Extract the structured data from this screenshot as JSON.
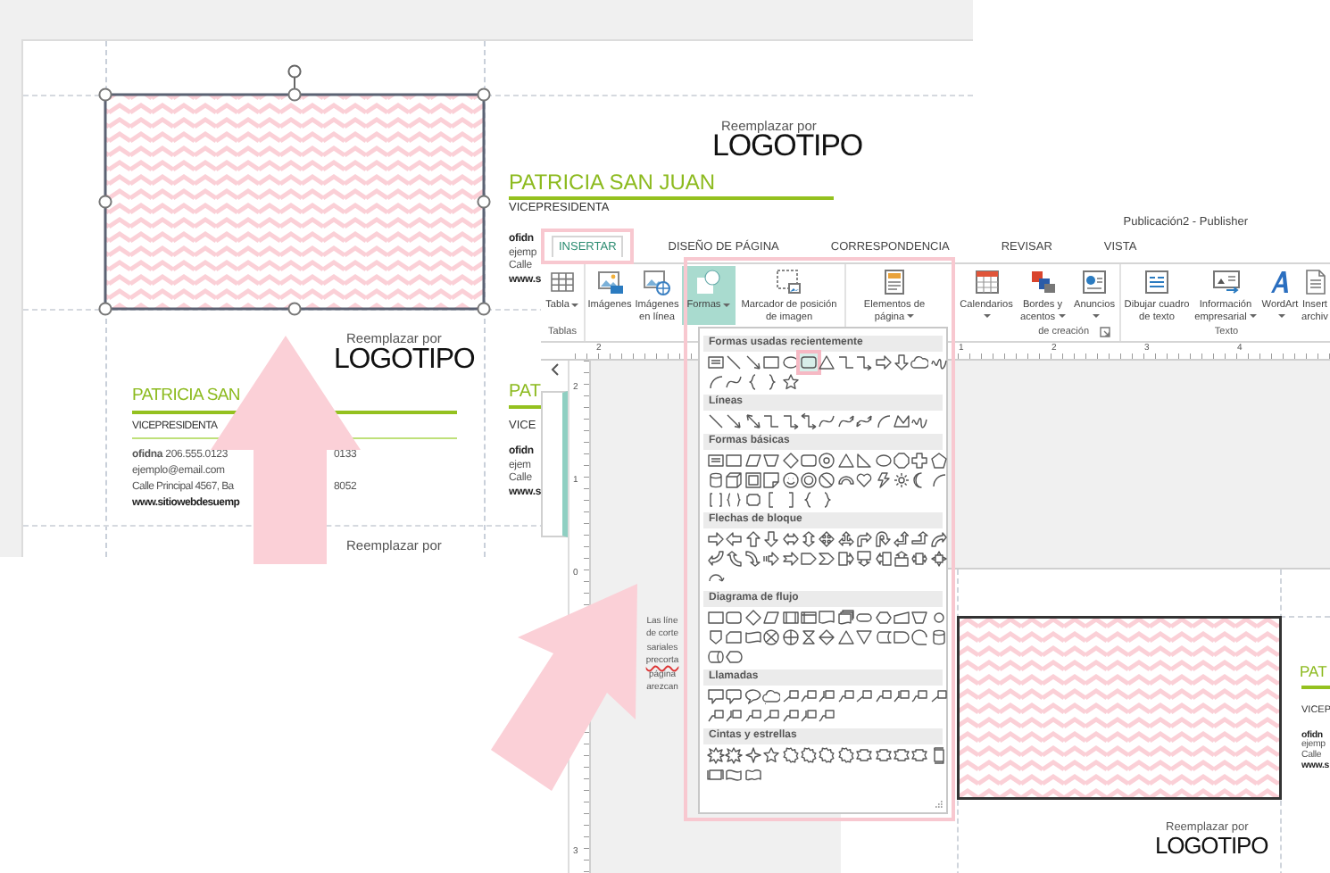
{
  "back_document": {
    "card_below": {
      "logo_caption": "Reemplazar por",
      "logo": "LOGOTIPO",
      "name": "PATRICIA SAN",
      "title": "VICEPRESIDENTA",
      "office": "**ofidna** 206.555.0123",
      "office_tail": "0133",
      "email": "ejemplo@email.com",
      "address": "Calle Principal 4567, Ba",
      "address_tail": "8052",
      "website": "www.sitiowebdesuemp"
    },
    "card_right": {
      "logo_caption": "Reemplazar por",
      "logo": "LOGOTIPO",
      "name": "PATRICIA SAN JUAN",
      "title": "VICEPRESIDENTA",
      "lines": [
        "ofidn",
        "ejemp",
        "Calle",
        "www.s"
      ]
    },
    "card_right_lower": {
      "name": "PAT",
      "title": "VICE",
      "lines": [
        "ofidn",
        "ejem",
        "Calle",
        "www.s"
      ]
    },
    "bottom_caption": "Reemplazar por"
  },
  "publisher": {
    "title": "Publicación2 - Publisher",
    "tabs": [
      {
        "label": "INSERTAR",
        "selected": true,
        "highlighted": true
      },
      {
        "label": "DISEÑO DE PÁGINA",
        "selected": false,
        "highlighted": false
      },
      {
        "label": "CORRESPONDENCIA",
        "selected": false,
        "highlighted": false
      },
      {
        "label": "REVISAR",
        "selected": false,
        "highlighted": false
      },
      {
        "label": "VISTA",
        "selected": false,
        "highlighted": false
      }
    ],
    "ribbon": [
      {
        "label": "Tablas",
        "buttons": [
          {
            "label": "Tabla",
            "kind": "table",
            "menu": true,
            "selected": false
          }
        ]
      },
      {
        "buttons": [
          {
            "label": "Imágenes",
            "kind": "picture",
            "menu": false,
            "selected": false
          },
          {
            "label": "Imágenes en línea",
            "kind": "online-picture",
            "menu": false,
            "selected": false
          },
          {
            "label": "Formas",
            "kind": "shapes",
            "menu": true,
            "selected": true
          },
          {
            "label": "Marcador de posición de imagen",
            "kind": "placeholder",
            "menu": false,
            "selected": false
          }
        ]
      },
      {
        "label": "de creación",
        "buttons": [
          {
            "label": "Elementos de página",
            "kind": "page-parts",
            "menu": true,
            "selected": false
          },
          {
            "label": "Calendarios",
            "kind": "calendar",
            "menu": true,
            "selected": false
          },
          {
            "label": "Bordes y acentos",
            "kind": "borders",
            "menu": true,
            "selected": false
          },
          {
            "label": "Anuncios",
            "kind": "advertisement",
            "menu": true,
            "selected": false
          }
        ]
      },
      {
        "label": "Texto",
        "buttons": [
          {
            "label": "Dibujar cuadro de texto",
            "kind": "text-box",
            "menu": false,
            "selected": false
          },
          {
            "label": "Información empresarial",
            "kind": "business",
            "menu": true,
            "selected": false
          },
          {
            "label": "WordArt",
            "kind": "wordart",
            "menu": true,
            "selected": false
          },
          {
            "label": "Insert archiv",
            "kind": "file",
            "menu": false,
            "selected": false
          }
        ]
      }
    ],
    "horizontal_ruler": {
      "left_labels": [
        "2"
      ],
      "right_labels": [
        "1",
        "2",
        "3",
        "4"
      ]
    },
    "vertical_ruler": {
      "upper_labels": [
        "2",
        "1",
        "0"
      ],
      "lower_labels": [
        "3"
      ]
    },
    "canvas_note": [
      {
        "text": "Las líne",
        "misspelled": false
      },
      {
        "text": "de corte",
        "misspelled": false
      },
      {
        "text": "sariales",
        "misspelled": false
      },
      {
        "text": "precorta",
        "misspelled": true
      },
      {
        "text": "página",
        "misspelled": false
      },
      {
        "text": "arezcan",
        "misspelled": false
      }
    ],
    "page_preview": {
      "name": "PAT",
      "title": "VICEP",
      "lines": [
        "ofidn",
        "ejemp",
        "Calle",
        "www.s"
      ],
      "logo_caption": "Reemplazar por",
      "logo": "LOGOTIPO"
    }
  },
  "shape_menu": {
    "sections": [
      {
        "title": "Formas usadas recientemente",
        "shapes": [
          {
            "kind": "textbox",
            "highlighted": false
          },
          {
            "kind": "line",
            "highlighted": false
          },
          {
            "kind": "arrow-line",
            "highlighted": false
          },
          {
            "kind": "rectangle",
            "highlighted": false
          },
          {
            "kind": "oval",
            "highlighted": false
          },
          {
            "kind": "rounded-rectangle",
            "highlighted": true
          },
          {
            "kind": "triangle",
            "highlighted": false
          },
          {
            "kind": "elbow",
            "highlighted": false
          },
          {
            "kind": "elbow-arrow",
            "highlighted": false
          },
          {
            "kind": "arrow-right",
            "highlighted": false
          },
          {
            "kind": "arrow-down",
            "highlighted": false
          },
          {
            "kind": "cloud",
            "highlighted": false
          },
          {
            "kind": "scribble",
            "highlighted": false
          },
          {
            "kind": "arc",
            "highlighted": false
          },
          {
            "kind": "curve",
            "highlighted": false
          },
          {
            "kind": "brace-left",
            "highlighted": false
          },
          {
            "kind": "brace-right",
            "highlighted": false
          },
          {
            "kind": "star",
            "highlighted": false
          }
        ]
      },
      {
        "title": "Líneas",
        "shapes": [
          {
            "kind": "line",
            "highlighted": false
          },
          {
            "kind": "arrow-line",
            "highlighted": false
          },
          {
            "kind": "double-arrow-line",
            "highlighted": false
          },
          {
            "kind": "elbow",
            "highlighted": false
          },
          {
            "kind": "elbow-arrow",
            "highlighted": false
          },
          {
            "kind": "elbow-double-arrow",
            "highlighted": false
          },
          {
            "kind": "curve",
            "highlighted": false
          },
          {
            "kind": "curve-arrow",
            "highlighted": false
          },
          {
            "kind": "curve-double-arrow",
            "highlighted": false
          },
          {
            "kind": "arc",
            "highlighted": false
          },
          {
            "kind": "freeform",
            "highlighted": false
          },
          {
            "kind": "scribble",
            "highlighted": false
          }
        ]
      },
      {
        "title": "Formas básicas",
        "shapes": [
          {
            "kind": "textbox",
            "highlighted": false
          },
          {
            "kind": "rectangle",
            "highlighted": false
          },
          {
            "kind": "parallelogram",
            "highlighted": false
          },
          {
            "kind": "trapezoid",
            "highlighted": false
          },
          {
            "kind": "diamond",
            "highlighted": false
          },
          {
            "kind": "rounded-rectangle",
            "highlighted": false
          },
          {
            "kind": "target",
            "highlighted": false
          },
          {
            "kind": "triangle",
            "highlighted": false
          },
          {
            "kind": "right-triangle",
            "highlighted": false
          },
          {
            "kind": "oval",
            "highlighted": false
          },
          {
            "kind": "octagon",
            "highlighted": false
          },
          {
            "kind": "cross",
            "highlighted": false
          },
          {
            "kind": "pentagon",
            "highlighted": false
          },
          {
            "kind": "cylinder",
            "highlighted": false
          },
          {
            "kind": "cube",
            "highlighted": false
          },
          {
            "kind": "frame",
            "highlighted": false
          },
          {
            "kind": "folded-corner",
            "highlighted": false
          },
          {
            "kind": "smiley",
            "highlighted": false
          },
          {
            "kind": "donut",
            "highlighted": false
          },
          {
            "kind": "no-symbol",
            "highlighted": false
          },
          {
            "kind": "block-arc",
            "highlighted": false
          },
          {
            "kind": "heart",
            "highlighted": false
          },
          {
            "kind": "lightning",
            "highlighted": false
          },
          {
            "kind": "sun",
            "highlighted": false
          },
          {
            "kind": "moon",
            "highlighted": false
          },
          {
            "kind": "arc",
            "highlighted": false
          },
          {
            "kind": "bracket-pair",
            "highlighted": false
          },
          {
            "kind": "brace-pair",
            "highlighted": false
          },
          {
            "kind": "plaque",
            "highlighted": false
          },
          {
            "kind": "bracket-left",
            "highlighted": false
          },
          {
            "kind": "bracket-right",
            "highlighted": false
          },
          {
            "kind": "brace-left",
            "highlighted": false
          },
          {
            "kind": "brace-right",
            "highlighted": false
          }
        ]
      },
      {
        "title": "Flechas de bloque",
        "shapes": [
          {
            "kind": "arrow-right",
            "highlighted": false
          },
          {
            "kind": "arrow-left",
            "highlighted": false
          },
          {
            "kind": "arrow-up",
            "highlighted": false
          },
          {
            "kind": "arrow-down",
            "highlighted": false
          },
          {
            "kind": "double-arrow-horizontal",
            "highlighted": false
          },
          {
            "kind": "double-arrow-vertical",
            "highlighted": false
          },
          {
            "kind": "quad-arrow",
            "highlighted": false
          },
          {
            "kind": "left-right-up-arrow",
            "highlighted": false
          },
          {
            "kind": "bent-arrow",
            "highlighted": false
          },
          {
            "kind": "u-turn-arrow",
            "highlighted": false
          },
          {
            "kind": "left-up-arrow",
            "highlighted": false
          },
          {
            "kind": "bent-up-arrow",
            "highlighted": false
          },
          {
            "kind": "curved-arrow-right",
            "highlighted": false
          },
          {
            "kind": "curved-arrow-left",
            "highlighted": false
          },
          {
            "kind": "curved-arrow-up",
            "highlighted": false
          },
          {
            "kind": "curved-arrow-down",
            "highlighted": false
          },
          {
            "kind": "striped-arrow",
            "highlighted": false
          },
          {
            "kind": "notched-arrow",
            "highlighted": false
          },
          {
            "kind": "pentagon-arrow",
            "highlighted": false
          },
          {
            "kind": "chevron",
            "highlighted": false
          },
          {
            "kind": "callout-arrow-right",
            "highlighted": false
          },
          {
            "kind": "callout-arrow-down",
            "highlighted": false
          },
          {
            "kind": "callout-arrow-left",
            "highlighted": false
          },
          {
            "kind": "callout-arrow-up",
            "highlighted": false
          },
          {
            "kind": "callout-arrow-left-right",
            "highlighted": false
          },
          {
            "kind": "callout-quad-arrow",
            "highlighted": false
          },
          {
            "kind": "circular-arrow",
            "highlighted": false
          }
        ]
      },
      {
        "title": "Diagrama de flujo",
        "shapes": [
          {
            "kind": "rectangle",
            "highlighted": false
          },
          {
            "kind": "rounded-rectangle",
            "highlighted": false
          },
          {
            "kind": "diamond",
            "highlighted": false
          },
          {
            "kind": "parallelogram",
            "highlighted": false
          },
          {
            "kind": "predefined-process",
            "highlighted": false
          },
          {
            "kind": "internal-storage",
            "highlighted": false
          },
          {
            "kind": "document",
            "highlighted": false
          },
          {
            "kind": "multi-document",
            "highlighted": false
          },
          {
            "kind": "terminator",
            "highlighted": false
          },
          {
            "kind": "hexagon",
            "highlighted": false
          },
          {
            "kind": "manual-input",
            "highlighted": false
          },
          {
            "kind": "trapezoid",
            "highlighted": false
          },
          {
            "kind": "connector",
            "highlighted": false
          },
          {
            "kind": "off-page",
            "highlighted": false
          },
          {
            "kind": "card",
            "highlighted": false
          },
          {
            "kind": "punched-tape",
            "highlighted": false
          },
          {
            "kind": "summing-junction",
            "highlighted": false
          },
          {
            "kind": "or-junction",
            "highlighted": false
          },
          {
            "kind": "collate",
            "highlighted": false
          },
          {
            "kind": "sort",
            "highlighted": false
          },
          {
            "kind": "triangle",
            "highlighted": false
          },
          {
            "kind": "merge",
            "highlighted": false
          },
          {
            "kind": "stored-data",
            "highlighted": false
          },
          {
            "kind": "delay",
            "highlighted": false
          },
          {
            "kind": "sequential-access",
            "highlighted": false
          },
          {
            "kind": "cylinder",
            "highlighted": false
          },
          {
            "kind": "direct-access",
            "highlighted": false
          },
          {
            "kind": "display",
            "highlighted": false
          }
        ]
      },
      {
        "title": "Llamadas",
        "shapes": [
          {
            "kind": "rectangle-callout",
            "highlighted": false
          },
          {
            "kind": "rounded-callout",
            "highlighted": false
          },
          {
            "kind": "oval-callout",
            "highlighted": false
          },
          {
            "kind": "cloud-callout",
            "highlighted": false
          },
          {
            "kind": "line-callout",
            "highlighted": false
          },
          {
            "kind": "bent-line-callout",
            "highlighted": false
          },
          {
            "kind": "accent-line-callout",
            "highlighted": false
          },
          {
            "kind": "double-bent-callout",
            "highlighted": false
          },
          {
            "kind": "line-callout",
            "highlighted": false
          },
          {
            "kind": "bent-line-callout",
            "highlighted": false
          },
          {
            "kind": "accent-line-callout",
            "highlighted": false
          },
          {
            "kind": "double-bent-callout",
            "highlighted": false
          },
          {
            "kind": "line-callout",
            "highlighted": false
          },
          {
            "kind": "bent-line-callout",
            "highlighted": false
          },
          {
            "kind": "accent-line-callout",
            "highlighted": false
          },
          {
            "kind": "double-bent-callout",
            "highlighted": false
          },
          {
            "kind": "line-callout",
            "highlighted": false
          },
          {
            "kind": "bent-line-callout",
            "highlighted": false
          },
          {
            "kind": "accent-line-callout",
            "highlighted": false
          },
          {
            "kind": "double-bent-callout",
            "highlighted": false
          }
        ]
      },
      {
        "title": "Cintas y estrellas",
        "shapes": [
          {
            "kind": "explosion",
            "highlighted": false
          },
          {
            "kind": "explosion",
            "highlighted": false
          },
          {
            "kind": "four-point-star",
            "highlighted": false
          },
          {
            "kind": "star",
            "highlighted": false
          },
          {
            "kind": "seal",
            "highlighted": false
          },
          {
            "kind": "seal",
            "highlighted": false
          },
          {
            "kind": "seal",
            "highlighted": false
          },
          {
            "kind": "seal",
            "highlighted": false
          },
          {
            "kind": "ribbon-down",
            "highlighted": false
          },
          {
            "kind": "ribbon-up",
            "highlighted": false
          },
          {
            "kind": "ribbon-down",
            "highlighted": false
          },
          {
            "kind": "ribbon-up",
            "highlighted": false
          },
          {
            "kind": "vertical-scroll",
            "highlighted": false
          },
          {
            "kind": "horizontal-scroll",
            "highlighted": false
          },
          {
            "kind": "wave",
            "highlighted": false
          },
          {
            "kind": "double-wave",
            "highlighted": false
          }
        ]
      }
    ]
  }
}
